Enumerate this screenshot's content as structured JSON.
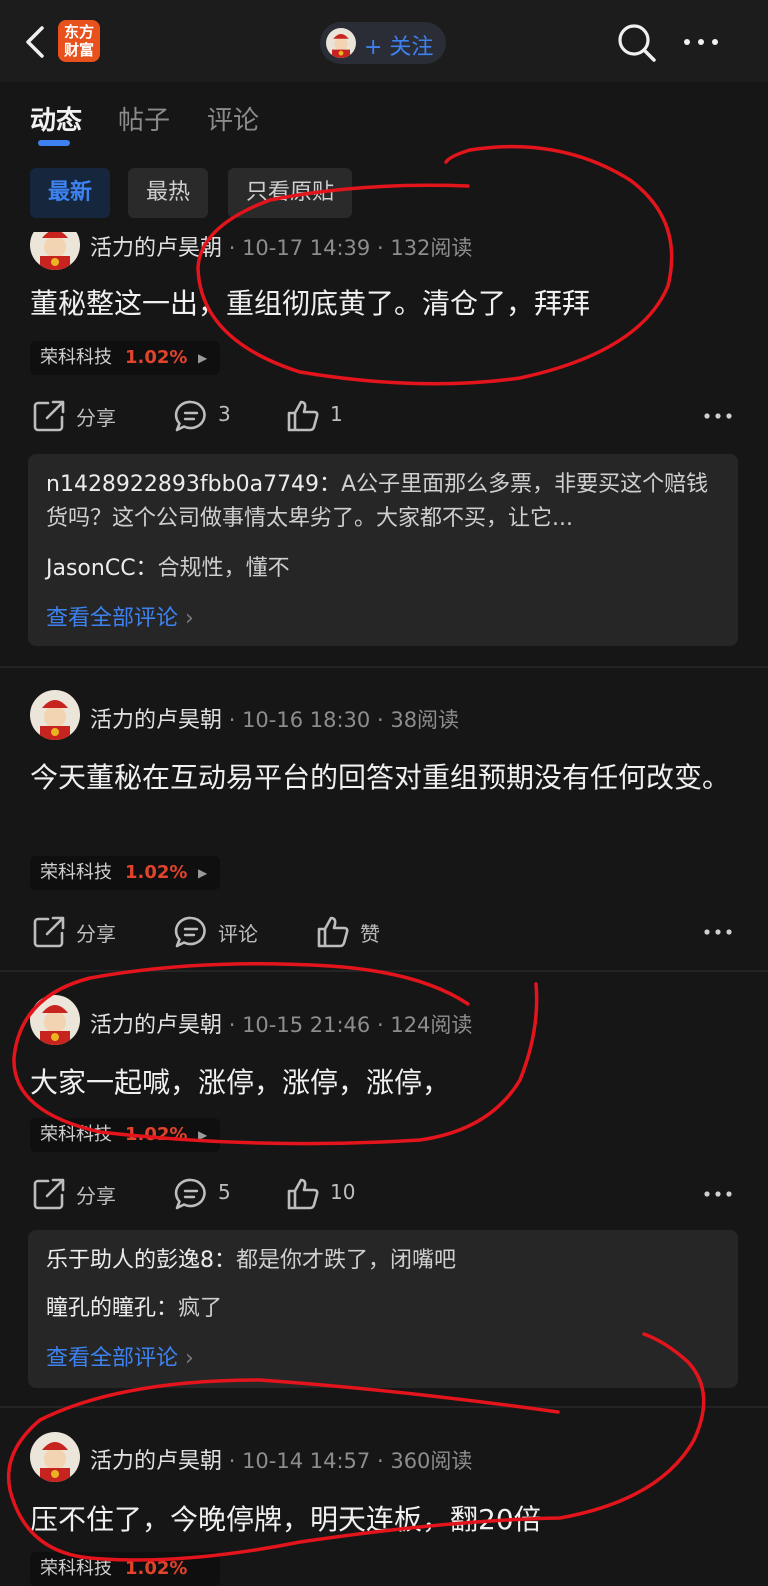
{
  "header": {
    "logo_line1": "东方",
    "logo_line2": "财富",
    "follow_label": "+ 关注",
    "icons": [
      "back-arrow-icon",
      "search-icon",
      "more-dots-icon"
    ]
  },
  "tabs": [
    {
      "label": "动态",
      "active": true
    },
    {
      "label": "帖子",
      "active": false
    },
    {
      "label": "评论",
      "active": false
    }
  ],
  "filters": [
    {
      "label": "最新",
      "active": true
    },
    {
      "label": "最热",
      "active": false
    },
    {
      "label": "只看原贴",
      "active": false
    }
  ],
  "colors": {
    "accent": "#3d82f0",
    "up": "#e0442d",
    "annotation": "#e3141b"
  },
  "posts": [
    {
      "author": "活力的卢昊朝",
      "date": "10-17 14:39",
      "reads": "132阅读",
      "content": "董秘整这一出，重组彻底黄了。清仓了，拜拜",
      "stock": {
        "name": "荣科科技",
        "change": "1.02%"
      },
      "share": "分享",
      "comment": "3",
      "like": "1",
      "comments": [
        {
          "user": "n1428922893fbb0a7749：",
          "text": "A公子里面那么多票，非要买这个赔钱货吗？这个公司做事情太卑劣了。大家都不买，让它..."
        },
        {
          "user": "JasonCC：",
          "text": "合规性，懂不"
        }
      ],
      "view_all": "查看全部评论"
    },
    {
      "author": "活力的卢昊朝",
      "date": "10-16 18:30",
      "reads": "38阅读",
      "content": "今天董秘在互动易平台的回答对重组预期没有任何改变。",
      "stock": {
        "name": "荣科科技",
        "change": "1.02%"
      },
      "share": "分享",
      "comment": "评论",
      "like": "赞"
    },
    {
      "author": "活力的卢昊朝",
      "date": "10-15 21:46",
      "reads": "124阅读",
      "content": "大家一起喊，涨停，涨停，涨停，",
      "stock": {
        "name": "荣科科技",
        "change": "1.02%"
      },
      "share": "分享",
      "comment": "5",
      "like": "10",
      "comments": [
        {
          "user": "乐于助人的彭逸8：",
          "text": "都是你才跌了，闭嘴吧"
        },
        {
          "user": "瞳孔的瞳孔：",
          "text": "疯了"
        }
      ],
      "view_all": "查看全部评论"
    },
    {
      "author": "活力的卢昊朝",
      "date": "10-14 14:57",
      "reads": "360阅读",
      "content": "压不住了，今晚停牌，明天连板，翻20倍",
      "stock": {
        "name": "荣科科技",
        "change": "1.02%"
      }
    }
  ]
}
